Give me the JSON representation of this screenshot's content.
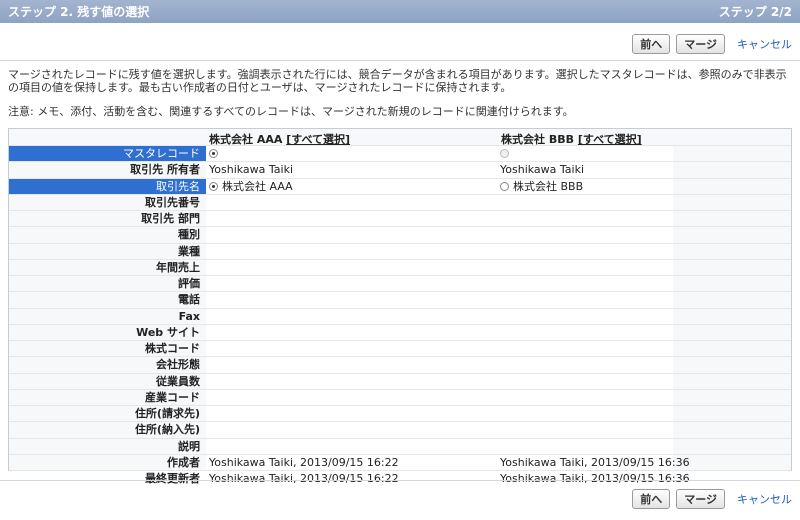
{
  "header": {
    "title": "ステップ 2. 残す値の選択",
    "step": "ステップ 2/2"
  },
  "buttons": {
    "prev": "前へ",
    "merge": "マージ",
    "cancel": "キャンセル"
  },
  "description": "マージされたレコードに残す値を選択します。強調表示された行には、競合データが含まれる項目があります。選択したマスタレコードは、参照のみで非表示の項目の値を保持します。最も古い作成者の日付とユーザは、マージされたレコードに保持されます。",
  "note": "注意: メモ、添付、活動を含む、関連するすべてのレコードは、マージされた新規のレコードに関連付けられます。",
  "columns": [
    {
      "name": "株式会社 AAA",
      "select_all": "[すべて選択]"
    },
    {
      "name": "株式会社 BBB",
      "select_all": "[すべて選択]"
    }
  ],
  "rows": [
    {
      "label": "マスタレコード",
      "a": "",
      "b": ""
    },
    {
      "label": "取引先 所有者",
      "a": "Yoshikawa Taiki",
      "b": "Yoshikawa Taiki"
    },
    {
      "label": "取引先名",
      "a": "株式会社 AAA",
      "b": "株式会社 BBB"
    },
    {
      "label": "取引先番号",
      "a": "",
      "b": ""
    },
    {
      "label": "取引先 部門",
      "a": "",
      "b": ""
    },
    {
      "label": "種別",
      "a": "",
      "b": ""
    },
    {
      "label": "業種",
      "a": "",
      "b": ""
    },
    {
      "label": "年間売上",
      "a": "",
      "b": ""
    },
    {
      "label": "評価",
      "a": "",
      "b": ""
    },
    {
      "label": "電話",
      "a": "",
      "b": ""
    },
    {
      "label": "Fax",
      "a": "",
      "b": ""
    },
    {
      "label": "Web サイト",
      "a": "",
      "b": ""
    },
    {
      "label": "株式コード",
      "a": "",
      "b": ""
    },
    {
      "label": "会社形態",
      "a": "",
      "b": ""
    },
    {
      "label": "従業員数",
      "a": "",
      "b": ""
    },
    {
      "label": "産業コード",
      "a": "",
      "b": ""
    },
    {
      "label": "住所(請求先)",
      "a": "",
      "b": ""
    },
    {
      "label": "住所(納入先)",
      "a": "",
      "b": ""
    },
    {
      "label": "説明",
      "a": "",
      "b": ""
    },
    {
      "label": "作成者",
      "a": "Yoshikawa Taiki, 2013/09/15 16:22",
      "b": "Yoshikawa Taiki, 2013/09/15 16:36"
    },
    {
      "label": "最終更新者",
      "a": "Yoshikawa Taiki, 2013/09/15 16:22",
      "b": "Yoshikawa Taiki, 2013/09/15 16:36"
    }
  ]
}
